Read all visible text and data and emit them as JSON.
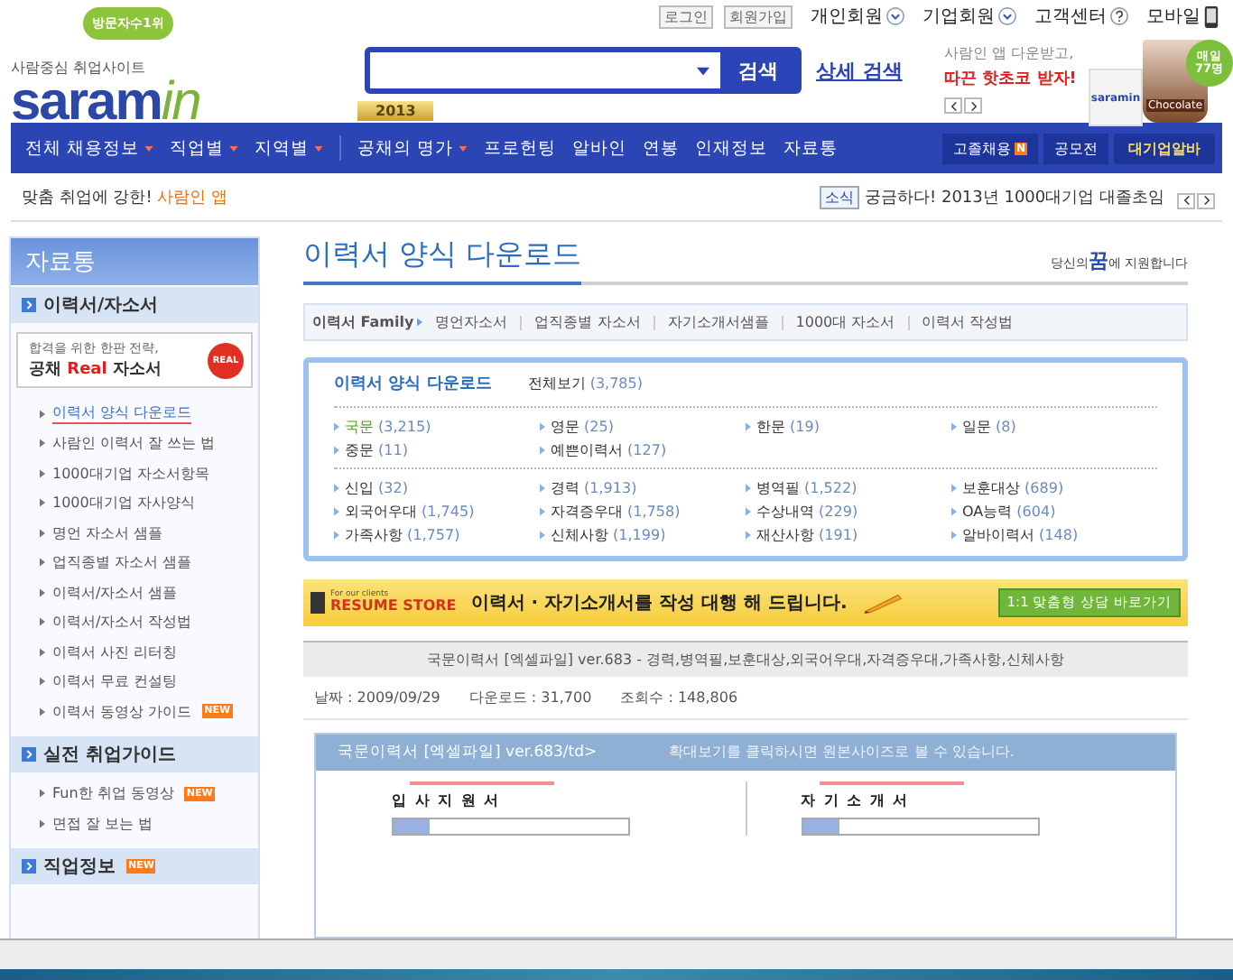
{
  "top_links": [
    {
      "label": "로그인",
      "kind": "boxed"
    },
    {
      "label": "회원가입",
      "kind": "boxed"
    },
    {
      "label": "개인회원",
      "kind": "dropdown"
    },
    {
      "label": "기업회원",
      "kind": "dropdown"
    },
    {
      "label": "고객센터",
      "kind": "help"
    },
    {
      "label": "모바일",
      "kind": "mobile"
    }
  ],
  "logo": {
    "badge": "방문자수1위",
    "tagline": "사람중심 취업사이트",
    "name": "saram",
    "accent": "in"
  },
  "search": {
    "button": "검색",
    "advanced": "상세 검색"
  },
  "ad": {
    "line1": "사람인 앱 다운받고,",
    "line2": "따끈 핫초코 받자!",
    "badge": [
      "매일",
      "77명"
    ],
    "app_logo": "saramin",
    "cup_label": "Chocolate"
  },
  "nav": {
    "ribbon": "2013",
    "items": [
      {
        "label": "전체 채용정보",
        "dropdown": true
      },
      {
        "label": "직업별",
        "dropdown": true
      },
      {
        "label": "지역별",
        "dropdown": true
      },
      {
        "label": "공채의 명가",
        "dropdown": true
      },
      {
        "label": "프로헌팅",
        "dropdown": false
      },
      {
        "label": "알바인",
        "dropdown": false
      },
      {
        "label": "연봉",
        "dropdown": false
      },
      {
        "label": "인재정보",
        "dropdown": false
      },
      {
        "label": "자료통",
        "dropdown": false
      }
    ],
    "right": [
      {
        "label": "고졸채용",
        "kind": "new",
        "badge": "N"
      },
      {
        "label": "공모전",
        "kind": "plain"
      },
      {
        "label": "대기업알바",
        "kind": "highlight"
      }
    ]
  },
  "notice": {
    "text": "맞춤 취업에 강한!",
    "highlight": "사람인 앱"
  },
  "ticker": {
    "tag": "소식",
    "text": "궁금하다! 2013년 1000대기업 대졸초임"
  },
  "sidebar": {
    "title": "자료통",
    "sections": [
      {
        "title": "이력서/자소서",
        "banner": {
          "line1": "합격을 위한 한판 전략,",
          "pre": "공채",
          "accent": "Real",
          "post": "자소서",
          "stamp": "REAL"
        },
        "items": [
          {
            "label": "이력서 양식 다운로드",
            "selected": true
          },
          {
            "label": "사람인 이력서 잘 쓰는 법",
            "selected": false
          },
          {
            "label": "1000대기업 자소서항목",
            "selected": false
          },
          {
            "label": "1000대기업 자사양식",
            "selected": false
          },
          {
            "label": "명언 자소서 샘플",
            "selected": false
          },
          {
            "label": "업직종별 자소서 샘플",
            "selected": false
          },
          {
            "label": "이력서/자소서 샘플",
            "selected": false
          },
          {
            "label": "이력서/자소서 작성법",
            "selected": false
          },
          {
            "label": "이력서 사진 리터칭",
            "selected": false
          },
          {
            "label": "이력서 무료 컨설팅",
            "selected": false
          },
          {
            "label": "이력서 동영상 가이드",
            "selected": false,
            "badge": "NEW"
          }
        ]
      },
      {
        "title": "실전 취업가이드",
        "items": [
          {
            "label": "Fun한 취업 동영상",
            "selected": false,
            "badge": "NEW"
          },
          {
            "label": "면접 잘 보는 법",
            "selected": false
          }
        ]
      },
      {
        "title": "직업정보",
        "badge": "NEW"
      }
    ]
  },
  "page": {
    "title": "이력서 양식 다운로드",
    "slogan_pre": "당신의",
    "slogan_big": "꿈",
    "slogan_post": "에 지원합니다"
  },
  "family": {
    "label": "이력서 Family",
    "links": [
      "명언자소서",
      "업직종별 자소서",
      "자기소개서샘플",
      "1000대 자소서",
      "이력서 작성법"
    ]
  },
  "categories": {
    "title": "이력서 양식 다운로드",
    "all": {
      "label": "전체보기",
      "count": "(3,785)"
    },
    "groups": [
      [
        {
          "label": "국문",
          "count": "(3,215)",
          "selected": true
        },
        {
          "label": "영문",
          "count": "(25)",
          "selected": false
        },
        {
          "label": "한문",
          "count": "(19)",
          "selected": false
        },
        {
          "label": "일문",
          "count": "(8)",
          "selected": false
        },
        {
          "label": "중문",
          "count": "(11)",
          "selected": false
        },
        {
          "label": "예쁜이력서",
          "count": "(127)",
          "selected": false
        }
      ],
      [
        {
          "label": "신입",
          "count": "(32)",
          "selected": false
        },
        {
          "label": "경력",
          "count": "(1,913)",
          "selected": false
        },
        {
          "label": "병역필",
          "count": "(1,522)",
          "selected": false
        },
        {
          "label": "보훈대상",
          "count": "(689)",
          "selected": false
        },
        {
          "label": "외국어우대",
          "count": "(1,745)",
          "selected": false
        },
        {
          "label": "자격증우대",
          "count": "(1,758)",
          "selected": false
        },
        {
          "label": "수상내역",
          "count": "(229)",
          "selected": false
        },
        {
          "label": "OA능력",
          "count": "(604)",
          "selected": false
        },
        {
          "label": "가족사항",
          "count": "(1,757)",
          "selected": false
        },
        {
          "label": "신체사항",
          "count": "(1,199)",
          "selected": false
        },
        {
          "label": "재산사항",
          "count": "(191)",
          "selected": false
        },
        {
          "label": "알바이력서",
          "count": "(148)",
          "selected": false
        }
      ]
    ]
  },
  "promo": {
    "brand_small": "For our clients",
    "brand": "RESUME STORE",
    "text": "이력서 · 자기소개서를 작성 대행 해 드립니다.",
    "button": "1:1 맞춤형 상담 바로가기"
  },
  "document": {
    "title": "국문이력서 [엑셀파일] ver.683 - 경력,병역필,보훈대상,외국어우대,자격증우대,가족사항,신체사항",
    "meta": [
      "날짜 : 2009/09/29",
      "다운로드 : 31,700",
      "조회수 : 148,806"
    ],
    "preview": {
      "title": "국문이력서 [엑셀파일] ver.683/td>",
      "hint": "확대보기를 클릭하시면 원본사이즈로 볼 수 있습니다.",
      "pages": [
        {
          "heading": "입 사 지 원 서"
        },
        {
          "heading": "자 기 소 개 서"
        }
      ]
    }
  }
}
